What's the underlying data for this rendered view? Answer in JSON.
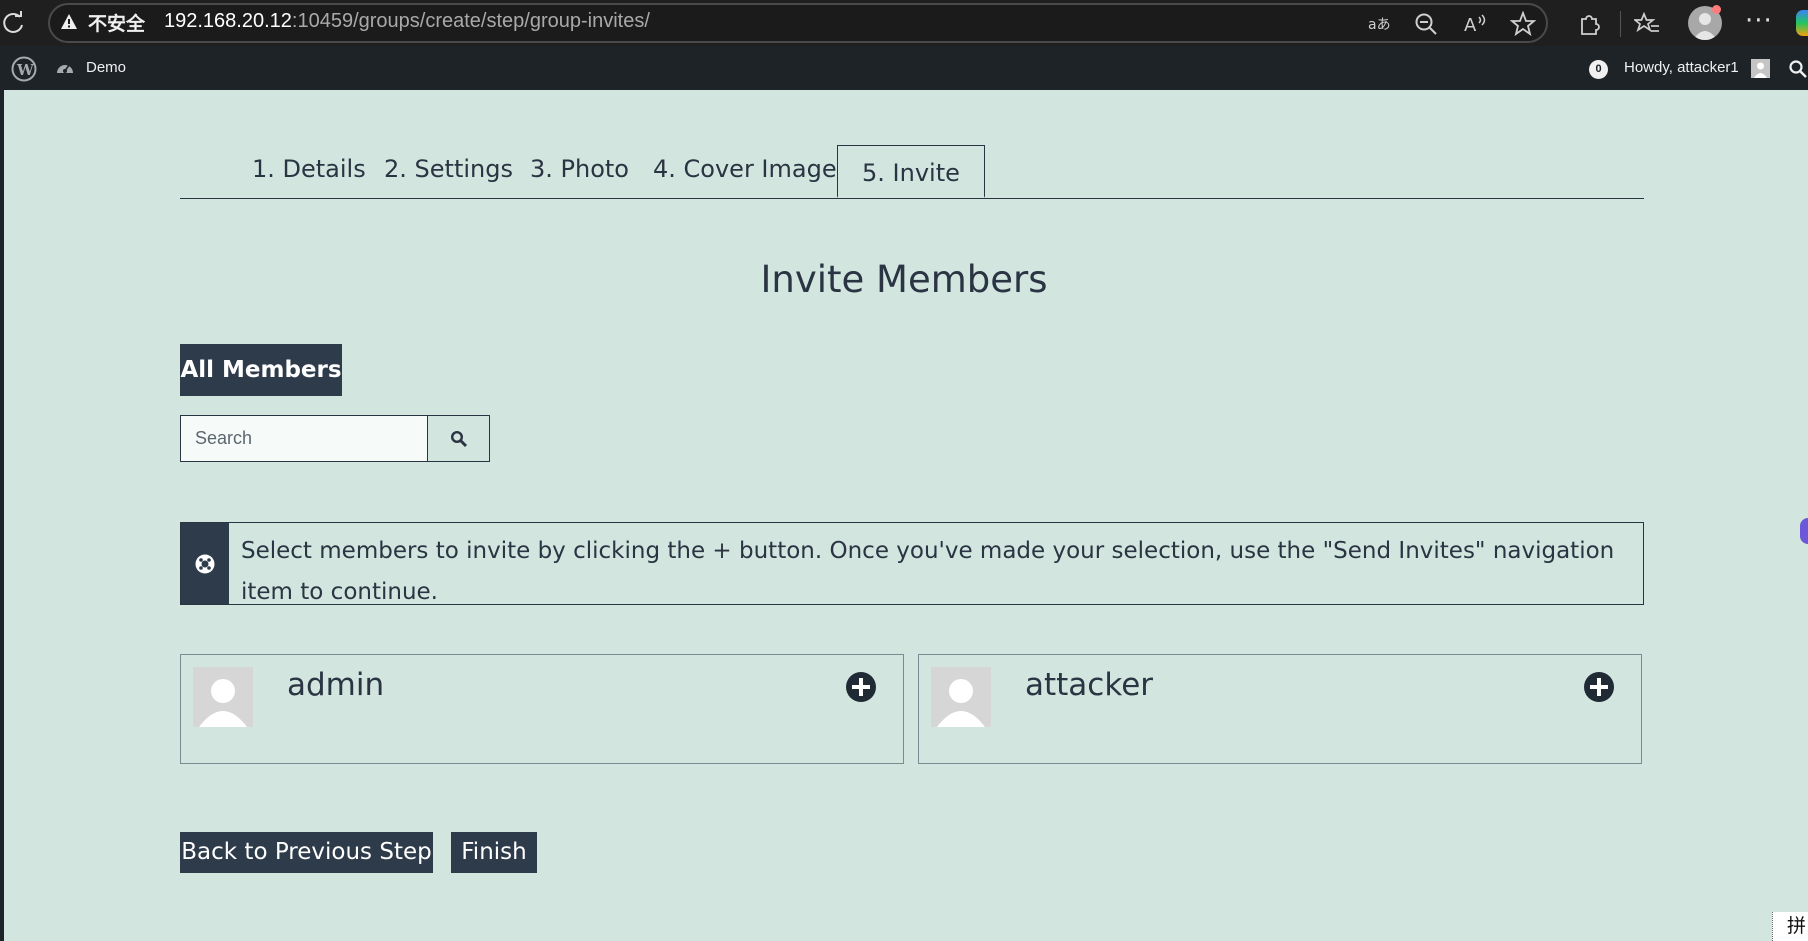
{
  "browser": {
    "insecure_label": "不安全",
    "url_host": "192.168.20.12",
    "url_rest": ":10459/groups/create/step/group-invites/",
    "more_label": "···"
  },
  "admin_bar": {
    "site_name": "Demo",
    "notification_count": "0",
    "greeting": "Howdy, attacker1"
  },
  "tabs": [
    {
      "label": "1. Details"
    },
    {
      "label": "2. Settings"
    },
    {
      "label": "3. Photo"
    },
    {
      "label": "4. Cover Image"
    },
    {
      "label": "5. Invite",
      "active": true
    }
  ],
  "page_title": "Invite Members",
  "filter": {
    "all_members_label": "All Members"
  },
  "search": {
    "placeholder": "Search"
  },
  "notice": {
    "text": "Select members to invite by clicking the + button. Once you've made your selection, use the \"Send Invites\" navigation item to continue."
  },
  "members": [
    {
      "name": "admin"
    },
    {
      "name": "attacker"
    }
  ],
  "actions": {
    "back_label": "Back to Previous Step",
    "finish_label": "Finish"
  },
  "ime": {
    "label": "拼"
  },
  "colors": {
    "page_bg": "#d2e5df",
    "dark_button": "#2e3b4a",
    "admin_bar": "#1d2327",
    "browser_bar": "#1f1f1f"
  }
}
